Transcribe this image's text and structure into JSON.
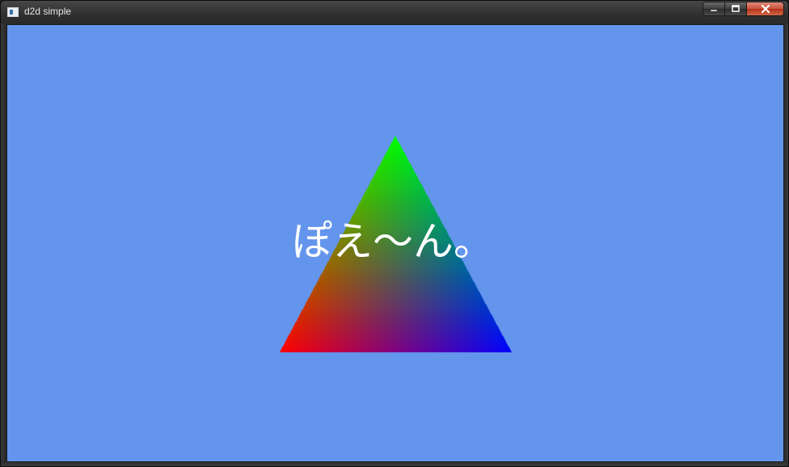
{
  "window": {
    "title": "d2d simple",
    "controls": {
      "minimize_icon": "minimize-icon",
      "maximize_icon": "maximize-icon",
      "close_icon": "close-icon"
    }
  },
  "canvas": {
    "background_color": "#6495ed",
    "triangle": {
      "vertex_colors": {
        "top": "#00ff00",
        "bottom_left": "#ff0000",
        "bottom_right": "#0000ff"
      }
    },
    "message": "ぽえ～ん。",
    "message_color": "#ffffff"
  }
}
